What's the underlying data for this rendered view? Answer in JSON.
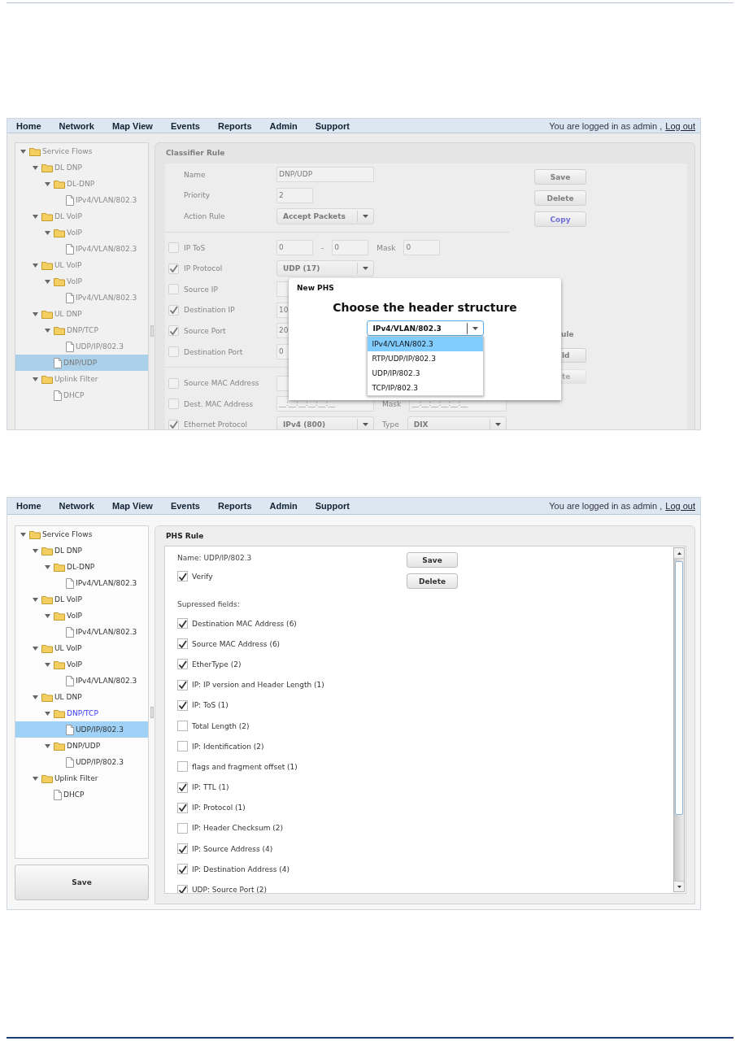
{
  "classifier_screen": {
    "nav": {
      "items": [
        "Home",
        "Network",
        "Map View",
        "Events",
        "Reports",
        "Admin",
        "Support"
      ],
      "login_text": "You are logged in as admin ,",
      "logout": "Log out"
    },
    "tree": [
      {
        "label": "Service Flows",
        "kind": "folder",
        "expanded": true,
        "selected": false,
        "children": [
          {
            "label": "DL DNP",
            "kind": "folder",
            "expanded": true,
            "selected": false,
            "children": [
              {
                "label": "DL-DNP",
                "kind": "folder",
                "expanded": true,
                "selected": false,
                "children": [
                  {
                    "label": "IPv4/VLAN/802.3",
                    "kind": "file",
                    "selected": false
                  }
                ]
              }
            ]
          },
          {
            "label": "DL VoIP",
            "kind": "folder",
            "expanded": true,
            "selected": false,
            "children": [
              {
                "label": "VoIP",
                "kind": "folder",
                "expanded": true,
                "selected": false,
                "children": [
                  {
                    "label": "IPv4/VLAN/802.3",
                    "kind": "file",
                    "selected": false
                  }
                ]
              }
            ]
          },
          {
            "label": "UL VoIP",
            "kind": "folder",
            "expanded": true,
            "selected": false,
            "children": [
              {
                "label": "VoIP",
                "kind": "folder",
                "expanded": true,
                "selected": false,
                "children": [
                  {
                    "label": "IPv4/VLAN/802.3",
                    "kind": "file",
                    "selected": false
                  }
                ]
              }
            ]
          },
          {
            "label": "UL DNP",
            "kind": "folder",
            "expanded": true,
            "selected": false,
            "children": [
              {
                "label": "DNP/TCP",
                "kind": "folder",
                "expanded": true,
                "selected": false,
                "children": [
                  {
                    "label": "UDP/IP/802.3",
                    "kind": "file",
                    "selected": false
                  }
                ]
              },
              {
                "label": "DNP/UDP",
                "kind": "file",
                "selected": true
              }
            ]
          },
          {
            "label": "Uplink Filter",
            "kind": "folder",
            "expanded": true,
            "selected": false,
            "children": [
              {
                "label": "DHCP",
                "kind": "file",
                "selected": false
              }
            ]
          }
        ]
      }
    ],
    "panel": {
      "title": "Classifier Rule",
      "fields": [
        {
          "label": "Name",
          "kind": "field",
          "value": "DNP/UDP"
        },
        {
          "label": "Priority",
          "kind": "short_field",
          "value": "2"
        },
        {
          "label": "Action Rule",
          "kind": "select",
          "value": "Accept Packets"
        }
      ],
      "buttons": [
        {
          "label": "Save",
          "kind": "plain"
        },
        {
          "label": "Delete",
          "kind": "plain"
        },
        {
          "label": "Copy",
          "kind": "link"
        }
      ],
      "criteria_groups": [
        [
          {
            "label": "IP ToS",
            "checked": false,
            "controls": [
              {
                "kind": "short_field",
                "value": "0"
              },
              {
                "kind": "text",
                "text": "-"
              },
              {
                "kind": "short_field",
                "value": "0"
              },
              {
                "kind": "text",
                "text": "Mask"
              },
              {
                "kind": "short_field",
                "value": "0"
              }
            ]
          },
          {
            "label": "IP Protocol",
            "checked": true,
            "controls": [
              {
                "kind": "select",
                "value": "UDP (17)"
              }
            ]
          },
          {
            "label": "Source IP",
            "checked": false,
            "controls": [
              {
                "kind": "field"
              }
            ]
          },
          {
            "label": "Destination IP",
            "checked": true,
            "controls": [
              {
                "kind": "field",
                "value": "10"
              }
            ]
          },
          {
            "label": "Source Port",
            "checked": true,
            "controls": [
              {
                "kind": "field",
                "value": "20"
              }
            ]
          },
          {
            "label": "Destination Port",
            "checked": false,
            "controls": [
              {
                "kind": "field",
                "value": "0"
              }
            ]
          }
        ],
        [
          {
            "label": "Source MAC Address",
            "checked": false,
            "controls": [
              {
                "kind": "field"
              }
            ]
          },
          {
            "label": "Dest. MAC Address",
            "checked": false,
            "controls": [
              {
                "kind": "field",
                "placeholder": "__:__:__:__:__:__"
              },
              {
                "kind": "text",
                "text": "Mask"
              },
              {
                "kind": "field",
                "placeholder": "__:__:__:__:__:__"
              }
            ]
          },
          {
            "label": "Ethernet Protocol",
            "checked": true,
            "controls": [
              {
                "kind": "select",
                "value": "IPv4 (800)"
              },
              {
                "kind": "text",
                "text": "Type"
              },
              {
                "kind": "wide_select",
                "value": "DIX"
              }
            ]
          }
        ]
      ],
      "rule_section": {
        "title": "ule",
        "buttons": [
          {
            "label": "ld",
            "disabled": false
          },
          {
            "label": "te",
            "disabled": true
          }
        ]
      }
    },
    "dialog": {
      "title": "New PHS",
      "heading": "Choose the header structure",
      "select": {
        "value": "IPv4/VLAN/802.3",
        "expanded": true
      },
      "options": [
        {
          "label": "IPv4/VLAN/802.3",
          "selected": true
        },
        {
          "label": "RTP/UDP/IP/802.3",
          "selected": false
        },
        {
          "label": "UDP/IP/802.3",
          "selected": false
        },
        {
          "label": "TCP/IP/802.3",
          "selected": false
        }
      ]
    }
  },
  "phs_screen": {
    "nav": {
      "items": [
        "Home",
        "Network",
        "Map View",
        "Events",
        "Reports",
        "Admin",
        "Support"
      ],
      "login_text": "You are logged in as admin ,",
      "logout": "Log out"
    },
    "tree": [
      {
        "label": "Service Flows",
        "kind": "folder",
        "expanded": true,
        "selected": false,
        "active": false,
        "children": [
          {
            "label": "DL DNP",
            "kind": "folder",
            "expanded": true,
            "selected": false,
            "active": false,
            "children": [
              {
                "label": "DL-DNP",
                "kind": "folder",
                "expanded": true,
                "selected": false,
                "active": false,
                "children": [
                  {
                    "label": "IPv4/VLAN/802.3",
                    "kind": "file",
                    "selected": false,
                    "active": false
                  }
                ]
              }
            ]
          },
          {
            "label": "DL VoIP",
            "kind": "folder",
            "expanded": true,
            "selected": false,
            "active": false,
            "children": [
              {
                "label": "VoIP",
                "kind": "folder",
                "expanded": true,
                "selected": false,
                "active": false,
                "children": [
                  {
                    "label": "IPv4/VLAN/802.3",
                    "kind": "file",
                    "selected": false,
                    "active": false
                  }
                ]
              }
            ]
          },
          {
            "label": "UL VoIP",
            "kind": "folder",
            "expanded": true,
            "selected": false,
            "active": false,
            "children": [
              {
                "label": "VoIP",
                "kind": "folder",
                "expanded": true,
                "selected": false,
                "active": false,
                "children": [
                  {
                    "label": "IPv4/VLAN/802.3",
                    "kind": "file",
                    "selected": false,
                    "active": false
                  }
                ]
              }
            ]
          },
          {
            "label": "UL DNP",
            "kind": "folder",
            "expanded": true,
            "selected": false,
            "active": false,
            "children": [
              {
                "label": "DNP/TCP",
                "kind": "folder",
                "expanded": true,
                "selected": false,
                "active": true,
                "children": [
                  {
                    "label": "UDP/IP/802.3",
                    "kind": "file",
                    "selected": true,
                    "active": false
                  }
                ]
              },
              {
                "label": "DNP/UDP",
                "kind": "folder",
                "expanded": true,
                "selected": false,
                "active": false,
                "children": [
                  {
                    "label": "UDP/IP/802.3",
                    "kind": "file",
                    "selected": false,
                    "active": false
                  }
                ]
              }
            ]
          },
          {
            "label": "Uplink Filter",
            "kind": "folder",
            "expanded": true,
            "selected": false,
            "active": false,
            "children": [
              {
                "label": "DHCP",
                "kind": "file",
                "selected": false,
                "active": false
              }
            ]
          }
        ]
      }
    ],
    "tree_save": "Save",
    "panel": {
      "title": "PHS Rule",
      "name": "Name: UDP/IP/802.3",
      "verify": {
        "label": "Verify",
        "checked": true
      },
      "buttons": [
        "Save",
        "Delete"
      ],
      "suppressed_title": "Supressed fields:",
      "fields": [
        {
          "label": "Destination MAC Address (6)",
          "checked": true
        },
        {
          "label": "Source MAC Address (6)",
          "checked": true
        },
        {
          "label": "EtherType (2)",
          "checked": true
        },
        {
          "label": "IP: IP version and Header Length (1)",
          "checked": true
        },
        {
          "label": "IP: ToS (1)",
          "checked": true
        },
        {
          "label": "Total Length (2)",
          "checked": false
        },
        {
          "label": "IP: Identification (2)",
          "checked": false
        },
        {
          "label": "flags and fragment offset (1)",
          "checked": false
        },
        {
          "label": "IP: TTL (1)",
          "checked": true
        },
        {
          "label": "IP: Protocol (1)",
          "checked": true
        },
        {
          "label": "IP: Header Checksum (2)",
          "checked": false
        },
        {
          "label": "IP: Source Address (4)",
          "checked": true
        },
        {
          "label": "IP: Destination Address (4)",
          "checked": true
        },
        {
          "label": "UDP: Source Port (2)",
          "checked": true
        }
      ]
    }
  }
}
